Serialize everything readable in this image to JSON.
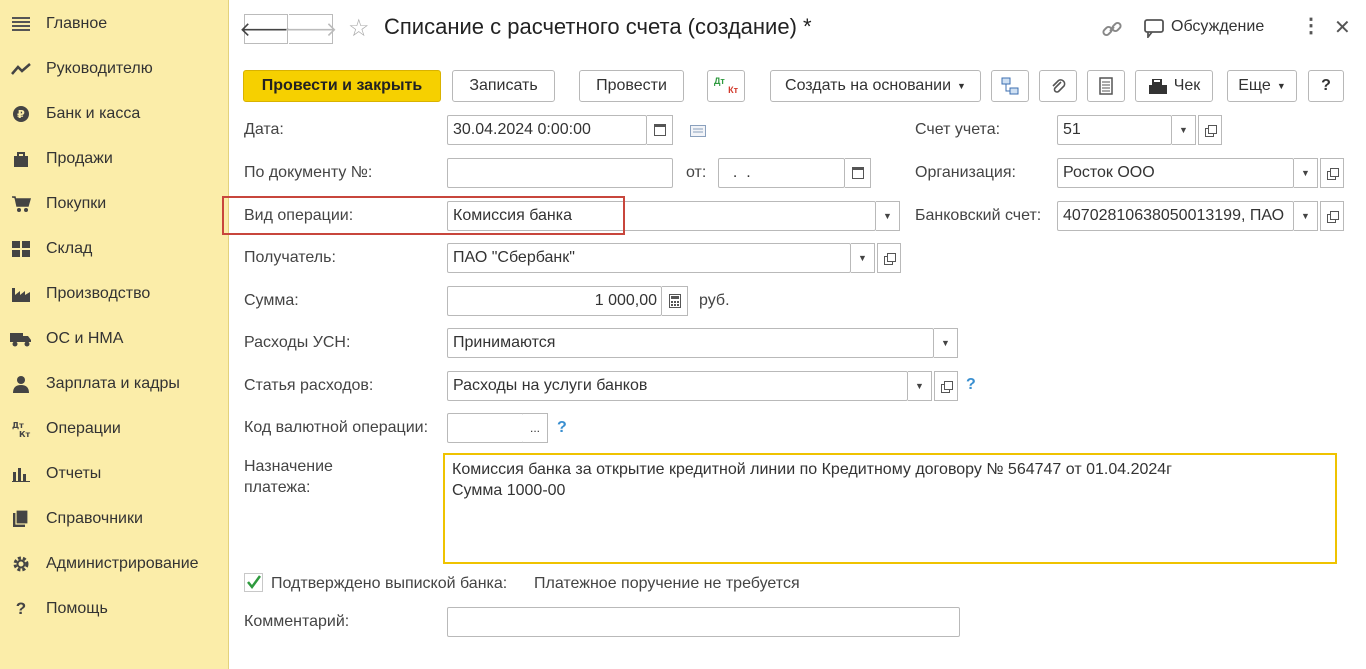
{
  "sidebar": {
    "items": [
      {
        "label": "Главное",
        "icon": "menu-icon"
      },
      {
        "label": "Руководителю",
        "icon": "trend-icon"
      },
      {
        "label": "Банк и касса",
        "icon": "ruble-icon"
      },
      {
        "label": "Продажи",
        "icon": "bag-icon"
      },
      {
        "label": "Покупки",
        "icon": "cart-icon"
      },
      {
        "label": "Склад",
        "icon": "grid-icon"
      },
      {
        "label": "Производство",
        "icon": "factory-icon"
      },
      {
        "label": "ОС и НМА",
        "icon": "truck-icon"
      },
      {
        "label": "Зарплата и кадры",
        "icon": "person-icon"
      },
      {
        "label": "Операции",
        "icon": "dt-kt-icon"
      },
      {
        "label": "Отчеты",
        "icon": "bar-chart-icon"
      },
      {
        "label": "Справочники",
        "icon": "books-icon"
      },
      {
        "label": "Администрирование",
        "icon": "gear-icon"
      },
      {
        "label": "Помощь",
        "icon": "question-icon"
      }
    ]
  },
  "header": {
    "title": "Списание с расчетного счета (создание) *",
    "discussion": "Обсуждение"
  },
  "toolbar": {
    "post_close": "Провести и закрыть",
    "save": "Записать",
    "post": "Провести",
    "dtkt_top": "Дт",
    "dtkt_bottom": "Кт",
    "create_based": "Создать на основании",
    "check": "Чек",
    "more": "Еще",
    "help": "?"
  },
  "form": {
    "date_label": "Дата:",
    "date_value": "30.04.2024  0:00:00",
    "docnum_label": "По документу №:",
    "docnum_value": "",
    "from_label": "от:",
    "from_value": "  .  .",
    "optype_label": "Вид операции:",
    "optype_value": "Комиссия банка",
    "recipient_label": "Получатель:",
    "recipient_value": "ПАО \"Сбербанк\"",
    "sum_label": "Сумма:",
    "sum_value": "1 000,00",
    "currency": "руб.",
    "usn_label": "Расходы УСН:",
    "usn_value": "Принимаются",
    "expense_label": "Статья расходов:",
    "expense_value": "Расходы на услуги банков",
    "fx_label": "Код валютной операции:",
    "fx_value": "",
    "fx_select": "...",
    "purpose_label_1": "Назначение",
    "purpose_label_2": "платежа:",
    "purpose_line1": "Комиссия банка за открытие кредитной линии по Кредитному договору № 564747 от 01.04.2024г",
    "purpose_line2": "Сумма 1000-00",
    "confirmed_label": "Подтверждено выпиской банка:",
    "confirmed_checked": true,
    "payment_order_note": "Платежное поручение не требуется",
    "comment_label": "Комментарий:",
    "comment_value": "",
    "account_label": "Счет учета:",
    "account_value": "51",
    "org_label": "Организация:",
    "org_value": "Росток ООО",
    "bank_label": "Банковский счет:",
    "bank_value": "40702810638050013199, ПАО",
    "help_mark": "?"
  }
}
